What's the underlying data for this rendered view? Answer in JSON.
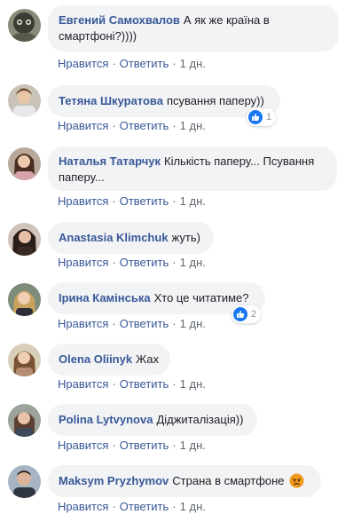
{
  "labels": {
    "like": "Нравится",
    "reply": "Ответить",
    "dot": "·"
  },
  "colors": {
    "author": "#385898",
    "bubble": "#f2f3f5",
    "like_blue": "#1877f2"
  },
  "comments": [
    {
      "author": "Евгений Самохвалов",
      "text": "А як же країна в смартфоні?))))",
      "time": "1 дн."
    },
    {
      "author": "Тетяна Шкуратова",
      "text": "псування паперу))",
      "time": "1 дн.",
      "reaction_icon": "like-icon",
      "reaction_count": "1"
    },
    {
      "author": "Наталья Татарчук",
      "text": "Кількість паперу... Псування паперу...",
      "time": "1 дн."
    },
    {
      "author": "Anastasia Klimchuk",
      "text": "жуть)",
      "time": "1 дн."
    },
    {
      "author": "Ірина Камінська",
      "text": "Хто це читатиме?",
      "time": "1 дн.",
      "reaction_icon": "like-icon",
      "reaction_count": "2"
    },
    {
      "author": "Olena Oliinyk",
      "text": "Жах",
      "time": "1 дн."
    },
    {
      "author": "Polina Lytvynova",
      "text": "Діджиталізація))",
      "time": "1 дн."
    },
    {
      "author": "Maksym Pryzhymov",
      "text": "Страна в смартфоне",
      "emoji": "angry-face-icon",
      "time": "1 дн."
    }
  ]
}
